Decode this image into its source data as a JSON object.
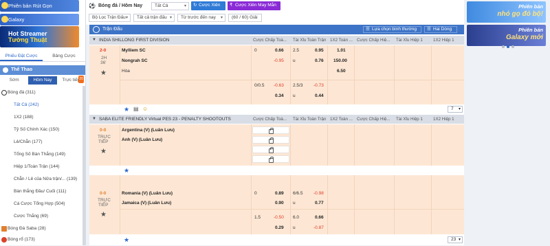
{
  "sidebar": {
    "banners": [
      "Phiên bản Rút Gọn",
      "Galaxy"
    ],
    "promo": {
      "line1": "Hot Streamer",
      "line2": "Tường Thuật"
    },
    "tabs": [
      "Phiếu Đặt Cược",
      "Bảng Cược"
    ],
    "sport": "Thể Thao",
    "subtabs": [
      "Sớm",
      "Hôm Nay",
      "Trực tiếp"
    ],
    "live_badge": "20",
    "items": [
      "Bóng đá (311)",
      "Tất Cả (242)",
      "1X2 (188)",
      "Tỷ Số Chính Xác (150)",
      "Lẻ/Chẵn (177)",
      "Tổng Số Bàn Thắng (149)",
      "Hiệp 1/Toàn Trận (144)",
      "Chẵn / Lẻ của Nửa trận/... (139)",
      "Bàn thắng Đầu/ Cuối (111)",
      "Cá Cược Tổng Hợp (504)",
      "Cược Thắng (69)",
      "Bóng Đá Saba (28)",
      "Bóng rổ (173)"
    ]
  },
  "topbar": {
    "title": "Bóng đá / Hôm Nay",
    "dd_all": "Tất Cả",
    "btn_xien": "Cược Xiên",
    "btn_xien_may": "Cược Xiên May Mắn",
    "filters": [
      "Bộ Lọc Trận Đấu",
      "Tất cả trận đấu",
      "Từ trước đến nay",
      "(60 / 60) Giải"
    ]
  },
  "ads": [
    {
      "line1": "Phiên bản",
      "line2": "nhỏ gọ đỏ bộ!"
    },
    {
      "line1": "Phiên bản",
      "line2": "Galaxy mới"
    }
  ],
  "grid": {
    "header": "Trận Đấu",
    "filter1": "Lựa chọn bình thường",
    "filter2": "Hai Dòng",
    "col_titles": [
      "Cược Chấp Toà...",
      "Tài Xỉu Toàn Trận",
      "1X2 Toàn ...",
      "Cược Chấp Hiệ...",
      "Tài Xỉu Hiệp 1",
      "1X2 Hiệp 1"
    ],
    "league1": {
      "name": "INDIA SHILLONG FIRST DIVISION",
      "score": "2-0",
      "time1": "2H",
      "time2": "36'",
      "home": "Mylliem SC",
      "away": "Nongrah SC",
      "draw": "Hòa",
      "r1": [
        "0",
        "0.66",
        "2.5",
        "0.95",
        "1.01"
      ],
      "r2": [
        "-0.95",
        "u",
        "0.76",
        "150.00"
      ],
      "r3": [
        "6.50"
      ],
      "r4": [
        "0/0.5",
        "-0.63",
        "2.5/3",
        "-0.73"
      ],
      "r5": [
        "0.34",
        "u",
        "0.44"
      ],
      "more": "7"
    },
    "league2": {
      "name": "SABA ELITE FRIENDLY Virtual PES 23 - PENALTY SHOOTOUTS",
      "m1": {
        "score": "0-0",
        "state1": "TRỰC",
        "state2": "TIẾP",
        "home": "Argentina (V) (Luân Lưu)",
        "away": "Anh (V) (Luân Lưu)"
      },
      "m2": {
        "score": "0-0",
        "state1": "TRỰC",
        "state2": "TIẾP",
        "home": "Romania (V) (Luân Lưu)",
        "away": "Jamaica (V) (Luân Lưu)",
        "r1": [
          "0",
          "0.89",
          "6/6.5",
          "-0.98"
        ],
        "r2": [
          "0.90",
          "u",
          "0.77"
        ],
        "r3": [
          "1.5",
          "-0.50",
          "6.0",
          "0.66"
        ],
        "r4": [
          "0.29",
          "u",
          "-0.87"
        ]
      },
      "more": "23"
    }
  }
}
